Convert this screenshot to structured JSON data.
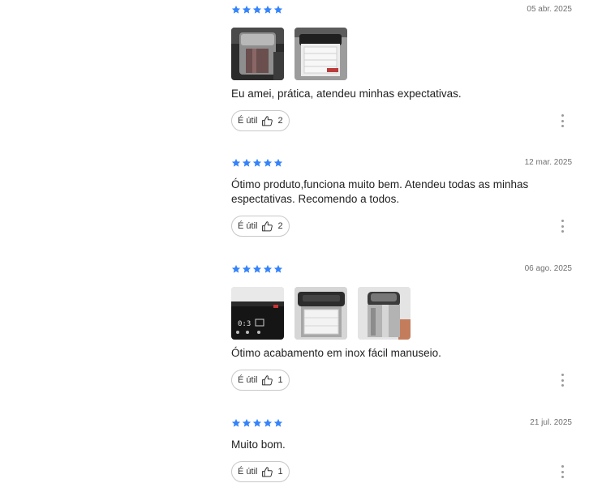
{
  "colors": {
    "star": "#3483fa",
    "text": "#1f1f1f",
    "muted": "#707070",
    "border": "#c8c8c8"
  },
  "icons": {
    "star": "star-icon",
    "like": "thumbs-up-icon",
    "more": "more-options-icon"
  },
  "reviews": [
    {
      "rating": 5,
      "date": "05 abr. 2025",
      "photos": [
        "product-photo-1",
        "product-photo-2"
      ],
      "text": "Eu amei, prática, atendeu minhas expectativas.",
      "helpful_label": "É útil",
      "helpful_count": "2"
    },
    {
      "rating": 5,
      "date": "12 mar. 2025",
      "photos": [],
      "text": "Ótimo produto,funciona muito bem. Atendeu todas as minhas espectativas. Recomendo a todos.",
      "helpful_label": "É útil",
      "helpful_count": "2"
    },
    {
      "rating": 5,
      "date": "06 ago. 2025",
      "photos": [
        "product-photo-1",
        "product-photo-2",
        "product-photo-3"
      ],
      "text": "Ótimo acabamento em inox fácil manuseio.",
      "helpful_label": "É útil",
      "helpful_count": "1"
    },
    {
      "rating": 5,
      "date": "21 jul. 2025",
      "photos": [],
      "text": "Muito bom.",
      "helpful_label": "É útil",
      "helpful_count": "1"
    }
  ]
}
